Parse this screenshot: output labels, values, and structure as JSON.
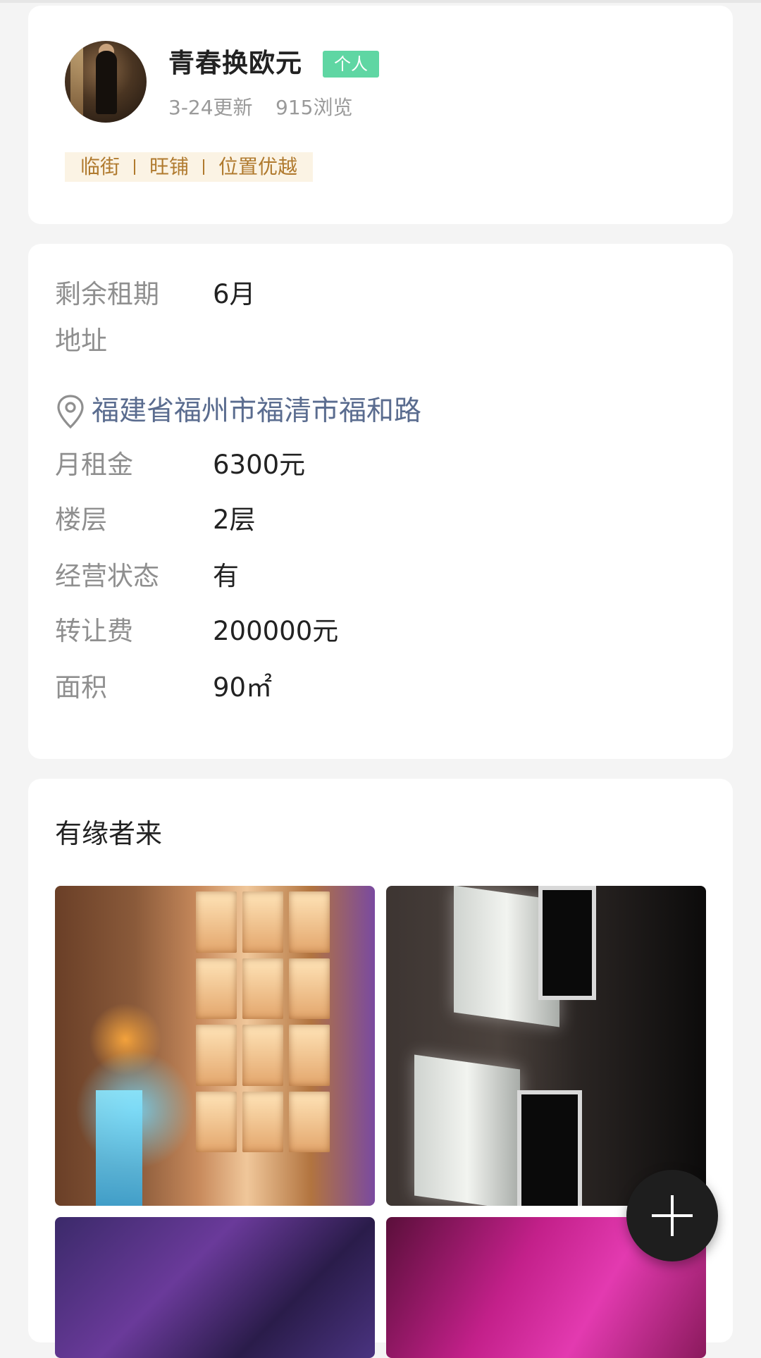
{
  "profile": {
    "username": "青春换欧元",
    "badge": "个人",
    "updated": "3-24更新",
    "views": "915浏览",
    "tags": [
      "临街",
      "旺铺",
      "位置优越"
    ]
  },
  "details": {
    "remaining_lease": {
      "label": "剩余租期",
      "value": "6月"
    },
    "address": {
      "label": "地址",
      "value": "福建省福州市福清市福和路"
    },
    "monthly_rent": {
      "label": "月租金",
      "value": "6300元"
    },
    "floor": {
      "label": "楼层",
      "value": "2层"
    },
    "operating_status": {
      "label": "经营状态",
      "value": "有"
    },
    "transfer_fee": {
      "label": "转让费",
      "value": "200000元"
    },
    "area": {
      "label": "面积",
      "value": "90㎡"
    }
  },
  "description": {
    "title": "有缘者来"
  },
  "icons": {
    "location": "location-pin-icon",
    "add": "plus-icon"
  },
  "colors": {
    "badge": "#5fd6a3",
    "tag_text": "#b07a2e",
    "tag_bg": "#fbf3e4",
    "address_link": "#5a6c8f",
    "fab": "#1e1e1e"
  }
}
